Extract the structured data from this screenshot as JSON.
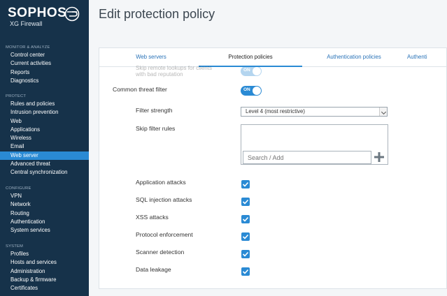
{
  "brand": {
    "name": "SOPHOS",
    "product": "XG Firewall"
  },
  "sidebar": {
    "sections": [
      {
        "heading": "MONITOR & ANALYZE",
        "items": [
          "Control center",
          "Current activities",
          "Reports",
          "Diagnostics"
        ]
      },
      {
        "heading": "PROTECT",
        "items": [
          "Rules and policies",
          "Intrusion prevention",
          "Web",
          "Applications",
          "Wireless",
          "Email",
          "Web server",
          "Advanced threat",
          "Central synchronization"
        ]
      },
      {
        "heading": "CONFIGURE",
        "items": [
          "VPN",
          "Network",
          "Routing",
          "Authentication",
          "System services"
        ]
      },
      {
        "heading": "SYSTEM",
        "items": [
          "Profiles",
          "Hosts and services",
          "Administration",
          "Backup & firmware",
          "Certificates"
        ]
      }
    ],
    "active_item": "Web server"
  },
  "page": {
    "title": "Edit protection policy"
  },
  "tabs": [
    "Web servers",
    "Protection policies",
    "Authentication policies",
    "Authenti"
  ],
  "active_tab": "Protection policies",
  "form": {
    "skip_remote_label_line1": "Skip remote lookups for clients",
    "skip_remote_label_line2": "with bad reputation",
    "skip_remote_toggle": "ON",
    "common_threat_label": "Common threat filter",
    "common_threat_toggle": "ON",
    "filter_strength_label": "Filter strength",
    "filter_strength_value": "Level 4 (most restrictive)",
    "skip_filter_rules_label": "Skip filter rules",
    "search_placeholder": "Search / Add",
    "checks": [
      {
        "label": "Application attacks",
        "checked": true
      },
      {
        "label": "SQL injection attacks",
        "checked": true
      },
      {
        "label": "XSS attacks",
        "checked": true
      },
      {
        "label": "Protocol enforcement",
        "checked": true
      },
      {
        "label": "Scanner detection",
        "checked": true
      },
      {
        "label": "Data leakage",
        "checked": true
      }
    ]
  },
  "colors": {
    "sidebar_bg": "#16324a",
    "accent": "#2a8ad4",
    "link": "#2a73b8"
  }
}
